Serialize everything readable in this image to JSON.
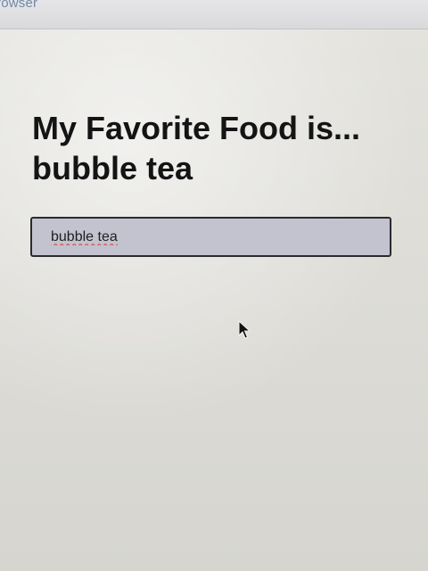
{
  "browser": {
    "title_fragment": "rowser"
  },
  "page": {
    "heading": "My Favorite Food is... bubble tea",
    "food_input": {
      "value": "bubble tea"
    }
  }
}
